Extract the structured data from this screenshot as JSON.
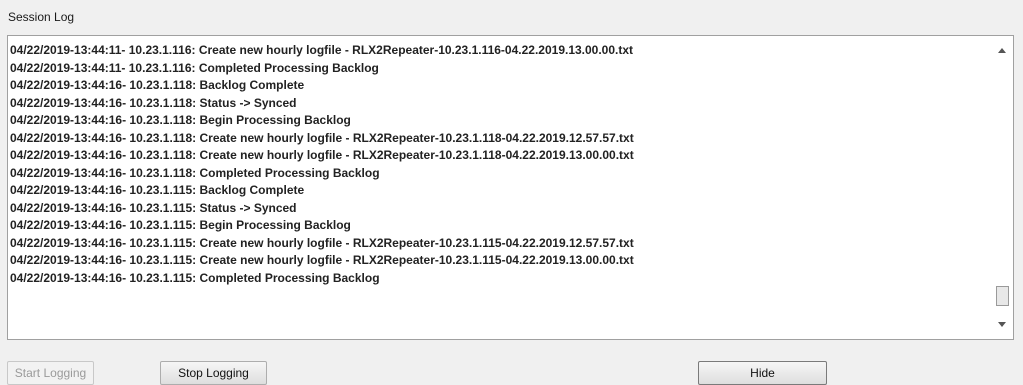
{
  "session_log": {
    "label": "Session Log",
    "lines": [
      "04/22/2019-13:44:11- 10.23.1.116: Create new hourly logfile - RLX2Repeater-10.23.1.116-04.22.2019.13.00.00.txt",
      "04/22/2019-13:44:11- 10.23.1.116: Completed Processing Backlog",
      "04/22/2019-13:44:16- 10.23.1.118: Backlog Complete",
      "04/22/2019-13:44:16- 10.23.1.118: Status -> Synced",
      "04/22/2019-13:44:16- 10.23.1.118: Begin Processing Backlog",
      "04/22/2019-13:44:16- 10.23.1.118: Create new hourly logfile - RLX2Repeater-10.23.1.118-04.22.2019.12.57.57.txt",
      "04/22/2019-13:44:16- 10.23.1.118: Create new hourly logfile - RLX2Repeater-10.23.1.118-04.22.2019.13.00.00.txt",
      "04/22/2019-13:44:16- 10.23.1.118: Completed Processing Backlog",
      "04/22/2019-13:44:16- 10.23.1.115: Backlog Complete",
      "04/22/2019-13:44:16- 10.23.1.115: Status -> Synced",
      "04/22/2019-13:44:16- 10.23.1.115: Begin Processing Backlog",
      "04/22/2019-13:44:16- 10.23.1.115: Create new hourly logfile - RLX2Repeater-10.23.1.115-04.22.2019.12.57.57.txt",
      "04/22/2019-13:44:16- 10.23.1.115: Create new hourly logfile - RLX2Repeater-10.23.1.115-04.22.2019.13.00.00.txt",
      "04/22/2019-13:44:16- 10.23.1.115: Completed Processing Backlog"
    ]
  },
  "buttons": {
    "start_logging": "Start Logging",
    "stop_logging": "Stop Logging",
    "hide": "Hide"
  }
}
